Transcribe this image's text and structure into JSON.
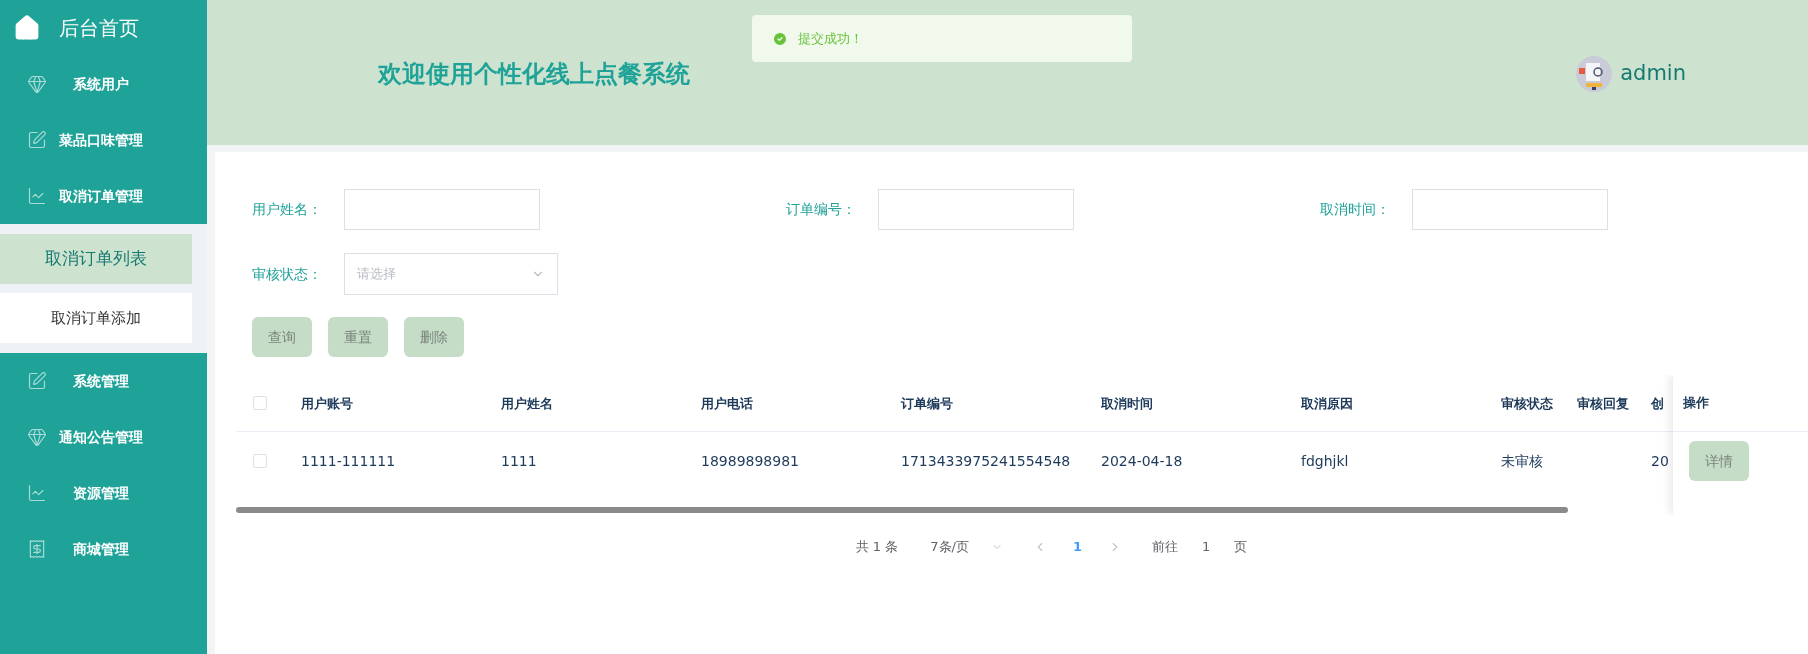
{
  "sidebar": {
    "home": {
      "label": "后台首页"
    },
    "items": [
      {
        "label": "系统用户"
      },
      {
        "label": "菜品口味管理"
      },
      {
        "label": "取消订单管理",
        "children": [
          {
            "label": "取消订单列表",
            "selected": true
          },
          {
            "label": "取消订单添加",
            "selected": false
          }
        ]
      },
      {
        "label": "系统管理"
      },
      {
        "label": "通知公告管理"
      },
      {
        "label": "资源管理"
      },
      {
        "label": "商城管理"
      }
    ]
  },
  "header": {
    "title": "欢迎使用个性化线上点餐系统",
    "toast": "提交成功！",
    "user": "admin"
  },
  "filters": [
    {
      "label": "用户姓名：",
      "kind": "input"
    },
    {
      "label": "订单编号：",
      "kind": "input"
    },
    {
      "label": "取消时间：",
      "kind": "input"
    },
    {
      "label": "审核状态：",
      "kind": "select",
      "placeholder": "请选择"
    }
  ],
  "buttons": [
    "查询",
    "重置",
    "删除"
  ],
  "table": {
    "header_checked": false,
    "columns": [
      "用户账号",
      "用户姓名",
      "用户电话",
      "订单编号",
      "取消时间",
      "取消原因",
      "审核状态",
      "审核回复",
      "创"
    ],
    "rows": [
      {
        "checked": false,
        "cells": [
          "1111-111111",
          "1111",
          "18989898981",
          "1713433975241554548",
          "2024-04-18",
          "fdghjkl",
          "未审核",
          "",
          "20"
        ],
        "action": "详情"
      }
    ],
    "action_column": "操作"
  },
  "pagination": {
    "total": "共 1 条",
    "page_size": "7条/页",
    "pages": [
      {
        "label": "1",
        "selected": true
      }
    ],
    "goto_label": "前往",
    "goto_value": "1",
    "goto_suffix": "页"
  }
}
